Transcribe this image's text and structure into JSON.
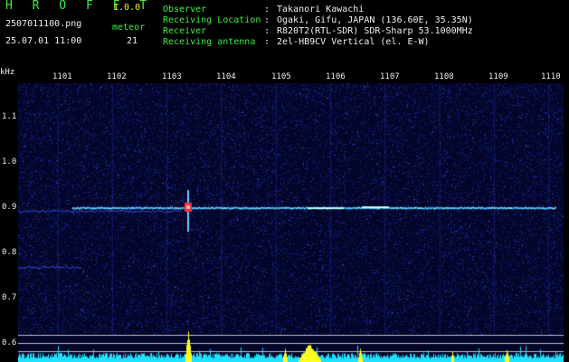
{
  "app": {
    "title": "H R O F F T",
    "version": "1.0.0"
  },
  "file": {
    "name": "2507011100.png",
    "datetime": "25.07.01 11:00"
  },
  "meteor": {
    "label": "meteor",
    "count": "21"
  },
  "info": {
    "rows": [
      {
        "key": "Observer",
        "sep": ":",
        "value": "Takanori Kawachi"
      },
      {
        "key": "Receiving Location",
        "sep": ":",
        "value": "Ogaki, Gifu, JAPAN (136.60E, 35.35N)"
      },
      {
        "key": "Receiver",
        "sep": ":",
        "value": "R820T2(RTL-SDR) SDR-Sharp 53.1000MHz"
      },
      {
        "key": "Receiving antenna",
        "sep": ":",
        "value": "2el-HB9CV Vertical (el. E-W)"
      }
    ]
  },
  "axis": {
    "y_unit": "kHz",
    "x_ticks": [
      "1101",
      "1102",
      "1103",
      "1104",
      "1105",
      "1106",
      "1107",
      "1108",
      "1109",
      "1110"
    ],
    "y_ticks": [
      "1.1",
      "1.0",
      "0.9",
      "0.8",
      "0.7",
      "0.6"
    ]
  },
  "colors": {
    "background": "#000000",
    "noise": "#1a2a9c",
    "trace": "#40c0ff",
    "spike": "#ff3030",
    "histogram": "#20e0ff",
    "histogram_peak": "#ffff20",
    "label_green": "#3cf03c",
    "label_white": "#f0f0f0"
  }
}
